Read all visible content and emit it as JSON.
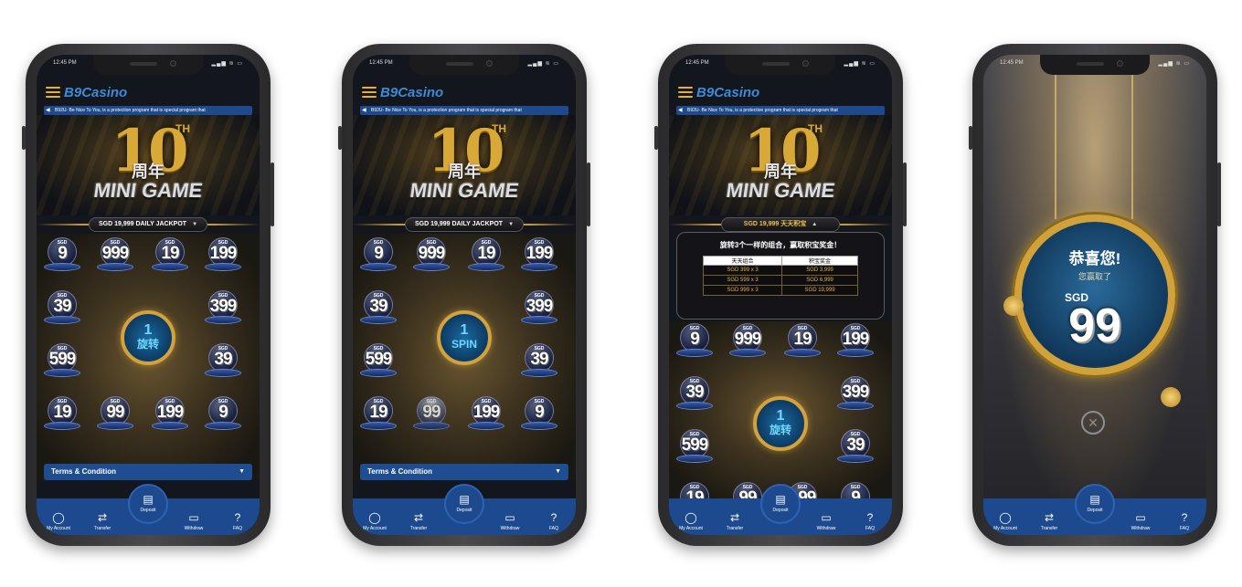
{
  "status": {
    "time": "12:45 PM",
    "icons": "▂▄▆ ≋ ▭"
  },
  "header": {
    "logo_b9": "B9",
    "logo_casino": "Casino"
  },
  "marquee": "B92U- Be Nice To You, is a protection program that is special program that",
  "hero": {
    "big": "10",
    "th": "TH",
    "zn": "周年",
    "mg": "MINI GAME"
  },
  "jackpot_en": "SGD 19,999 DAILY JACKPOT",
  "jackpot_zh": "SGD 19,999 天天积宝",
  "prizes": {
    "row1": [
      "9",
      "999",
      "19",
      "199"
    ],
    "row2": [
      "39",
      "399"
    ],
    "row3": [
      "599",
      "39"
    ],
    "row4": [
      "19",
      "99",
      "199",
      "9"
    ],
    "sgd": "SGD"
  },
  "spin": {
    "count": "1",
    "label_zh": "旋转",
    "label_en": "SPIN"
  },
  "terms": "Terms & Condition",
  "popup": {
    "heading": "旋转3个一样的组合，赢取积宝奖金！",
    "col1": "天天组合",
    "col2": "积宝奖金",
    "rows": [
      [
        "SGD 399 x 3",
        "SGD 3,999"
      ],
      [
        "SGD 599 x 3",
        "SGD 6,999"
      ],
      [
        "SGD 999 x 3",
        "SGD 19,999"
      ]
    ]
  },
  "win": {
    "title": "恭喜您!",
    "subtitle": "您赢取了",
    "currency": "SGD",
    "amount": "99"
  },
  "nav": [
    "My Account",
    "Transfer",
    "Deposit",
    "Withdraw",
    "FAQ"
  ]
}
